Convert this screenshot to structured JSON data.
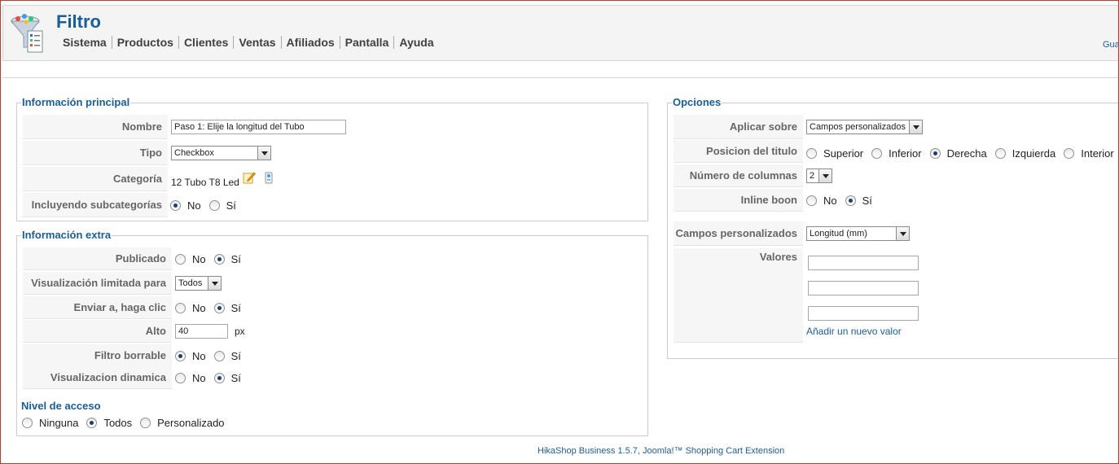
{
  "header": {
    "title": "Filtro",
    "menu": [
      "Sistema",
      "Productos",
      "Clientes",
      "Ventas",
      "Afiliados",
      "Pantalla",
      "Ayuda"
    ],
    "save_link": "Gua"
  },
  "main": {
    "legend": "Información principal",
    "nombre_label": "Nombre",
    "nombre_value": "Paso 1: Elije la longitud del Tubo",
    "tipo_label": "Tipo",
    "tipo_value": "Checkbox",
    "categoria_label": "Categoría",
    "categoria_value": "12 Tubo T8 Led",
    "subcat_label": "Incluyendo subcategorías",
    "no": "No",
    "si": "Sí"
  },
  "extra": {
    "legend": "Información extra",
    "publicado_label": "Publicado",
    "vis_limitada_label": "Visualización limitada para",
    "vis_limitada_value": "Todos",
    "enviar_label": "Enviar a, haga clic",
    "alto_label": "Alto",
    "alto_value": "40",
    "alto_unit": "px",
    "borrable_label": "Filtro borrable",
    "dinamica_label": "Visualizacion dinamica",
    "no": "No",
    "si": "Sí",
    "access_title": "Nivel de acceso",
    "access_options": [
      "Ninguna",
      "Todos",
      "Personalizado"
    ]
  },
  "options": {
    "legend": "Opciones",
    "aplicar_label": "Aplicar sobre",
    "aplicar_value": "Campos personalizados",
    "posicion_label": "Posicion del titulo",
    "posicion_options": [
      "Superior",
      "Inferior",
      "Derecha",
      "Izquierda",
      "Interior"
    ],
    "columnas_label": "Número de columnas",
    "columnas_value": "2",
    "inline_label": "Inline boon",
    "no": "No",
    "si": "Sí",
    "campos_label": "Campos personalizados",
    "campos_value": "Longitud (mm)",
    "valores_label": "Valores",
    "valores": [
      "",
      "",
      ""
    ],
    "add_value_link": "Añadir un nuevo valor"
  },
  "footer": "HikaShop Business 1.5.7, Joomla!™ Shopping Cart Extension",
  "colors": {
    "accent": "#1a5e96",
    "label_bg": "#f6f6f6",
    "frame": "#c0392b"
  }
}
